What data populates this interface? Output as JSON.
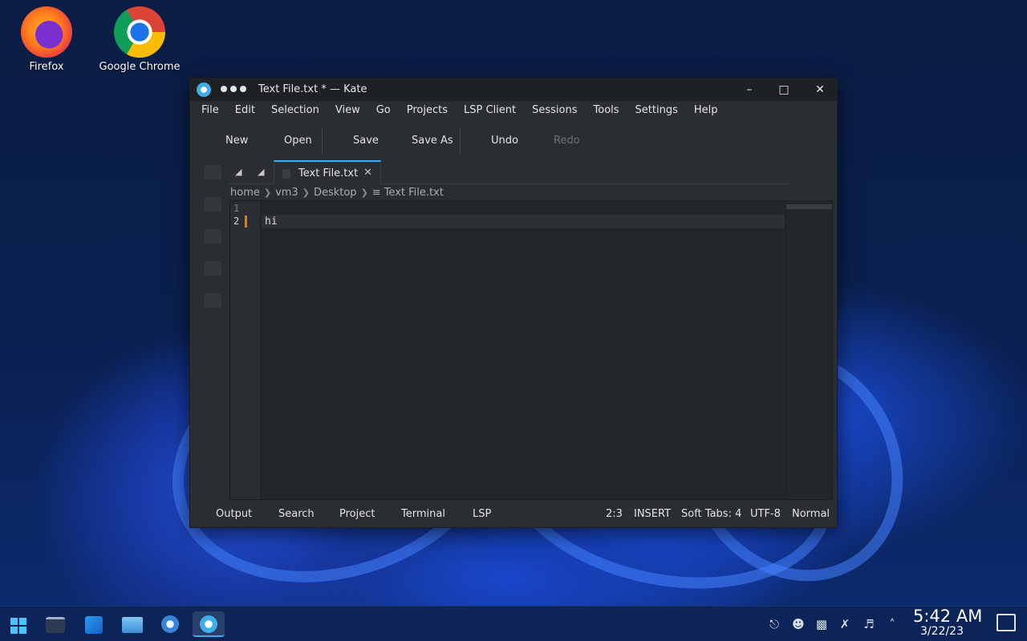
{
  "desktop": {
    "icons": [
      {
        "label": "Firefox",
        "icon": "firefox-icon"
      },
      {
        "label": "Google Chrome",
        "icon": "chrome-icon"
      }
    ]
  },
  "window": {
    "title": "Text File.txt * — Kate",
    "controls": [
      "minimize-icon",
      "maximize-icon",
      "close-icon"
    ]
  },
  "menu": {
    "items": [
      "File",
      "Edit",
      "Selection",
      "View",
      "Go",
      "Projects",
      "LSP Client",
      "Sessions",
      "Tools",
      "Settings",
      "Help"
    ]
  },
  "toolbar": {
    "new": "New",
    "open": "Open",
    "save": "Save",
    "save_as": "Save As",
    "undo": "Undo",
    "redo": "Redo"
  },
  "tabs": {
    "active": "Text File.txt",
    "close_glyph": "✕"
  },
  "breadcrumb": {
    "parts": [
      "home",
      "vm3",
      "Desktop",
      "Text File.txt"
    ]
  },
  "editor": {
    "line_numbers": [
      "1",
      "2"
    ],
    "lines": [
      "",
      "hi"
    ]
  },
  "statusbar": {
    "panels": [
      "Output",
      "Search",
      "Project",
      "Terminal",
      "LSP"
    ],
    "cursor_position": "2:3",
    "mode": "INSERT",
    "indent": "Soft Tabs: 4",
    "encoding": "UTF-8",
    "input_mode": "Normal"
  },
  "taskbar": {
    "time": "5:42 AM",
    "date": "3/22/23"
  },
  "colors": {
    "accent": "#3daee9",
    "modified_marker": "#f67400",
    "editor_bg": "#232629"
  }
}
